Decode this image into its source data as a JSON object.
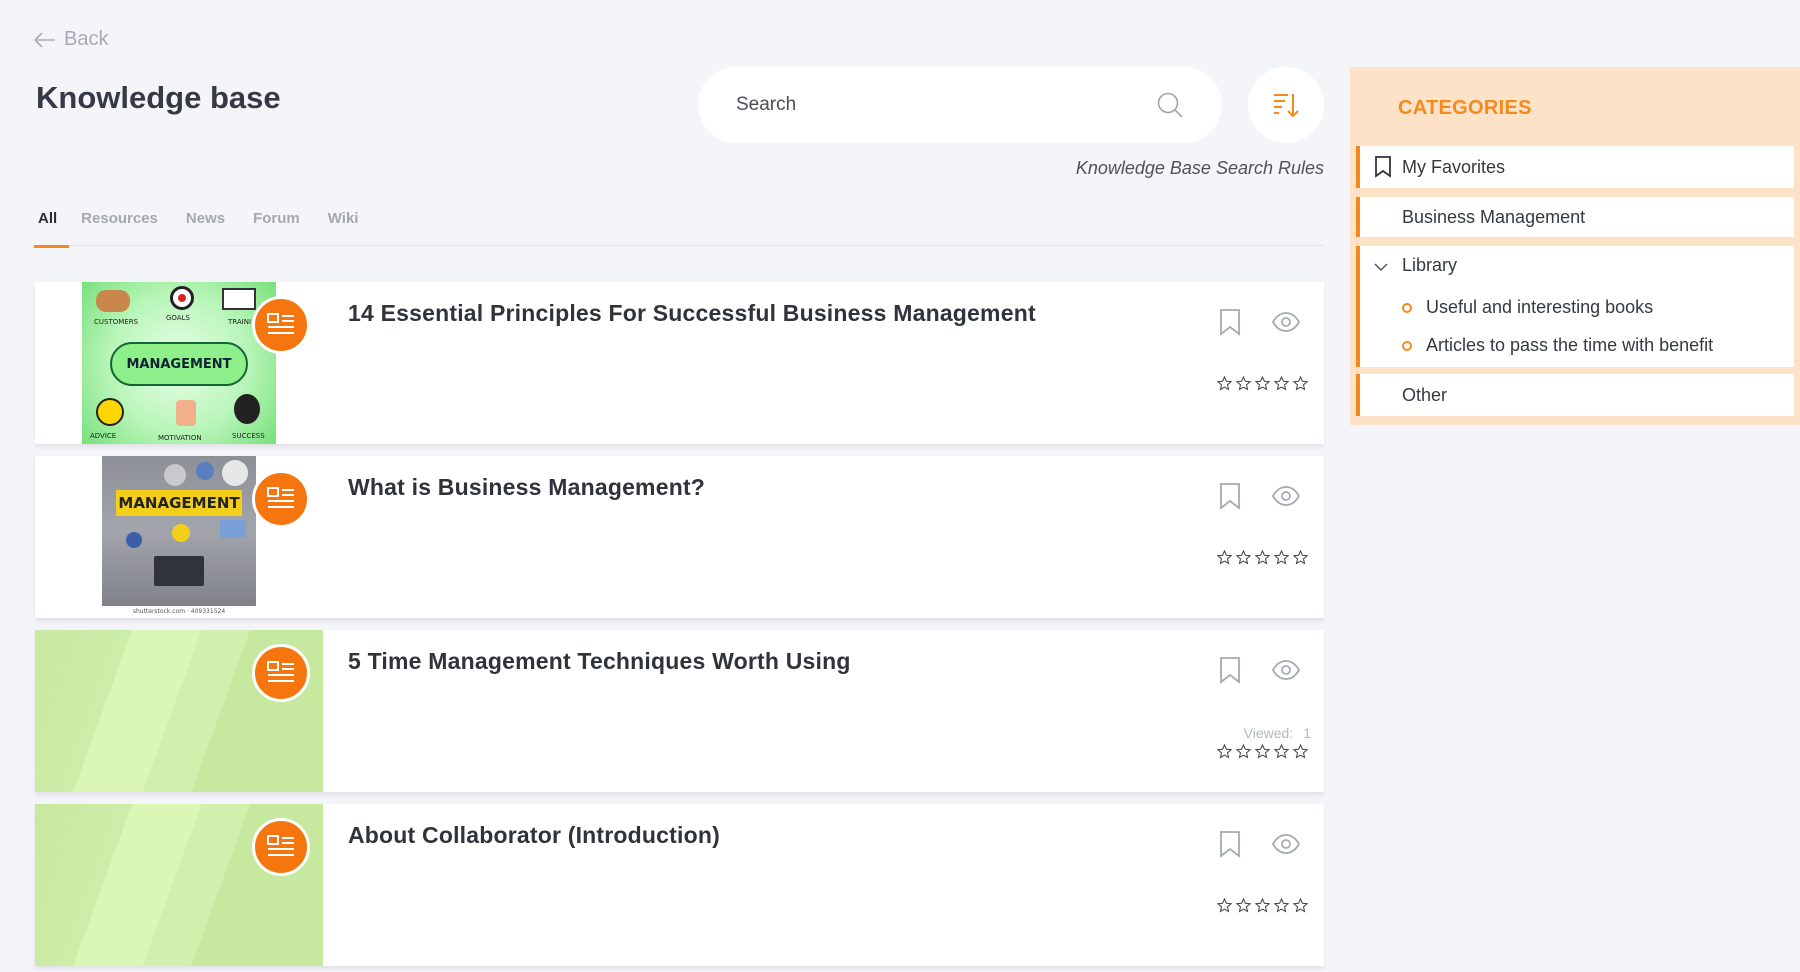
{
  "header": {
    "back_label": "Back",
    "page_title": "Knowledge base",
    "search_placeholder": "Search",
    "rules_link": "Knowledge Base Search Rules"
  },
  "tabs": [
    {
      "label": "All",
      "active": true
    },
    {
      "label": "Resources",
      "active": false
    },
    {
      "label": "News",
      "active": false
    },
    {
      "label": "Forum",
      "active": false
    },
    {
      "label": "Wiki",
      "active": false
    }
  ],
  "articles": [
    {
      "title": "14 Essential Principles For Successful Business Management",
      "thumbnail": "management-diagram",
      "thumbnail_text": {
        "cloud": "MANAGEMENT",
        "tags": [
          "CUSTOMERS",
          "GOALS",
          "TRAINI",
          "ADVICE",
          "MOTIVATION",
          "SUCCESS"
        ]
      },
      "viewed": null,
      "rating": 0
    },
    {
      "title": "What is Business Management?",
      "thumbnail": "management-laptop",
      "thumbnail_text": {
        "banner": "MANAGEMENT",
        "caption": "shutterstock.com · 409331524"
      },
      "viewed": null,
      "rating": 0
    },
    {
      "title": "5 Time Management Techniques Worth Using",
      "thumbnail": "green-placeholder",
      "viewed": {
        "label": "Viewed:",
        "count": "1"
      },
      "rating": 0
    },
    {
      "title": "About Collaborator (Introduction)",
      "thumbnail": "green-placeholder",
      "viewed": null,
      "rating": 0
    }
  ],
  "categories": {
    "title": "CATEGORIES",
    "items": [
      {
        "label": "My Favorites",
        "icon": "bookmark-icon"
      },
      {
        "label": "Business Management",
        "icon": null
      },
      {
        "label": "Library",
        "icon": "chevron-down-icon",
        "expanded": true,
        "children": [
          "Useful and interesting books",
          "Articles to pass the time with benefit"
        ]
      },
      {
        "label": "Other",
        "icon": null
      }
    ]
  },
  "colors": {
    "accent": "#f28a1e",
    "badge": "#f5750f",
    "background": "#f4f5f9",
    "categories_bg": "#fde2c8"
  }
}
